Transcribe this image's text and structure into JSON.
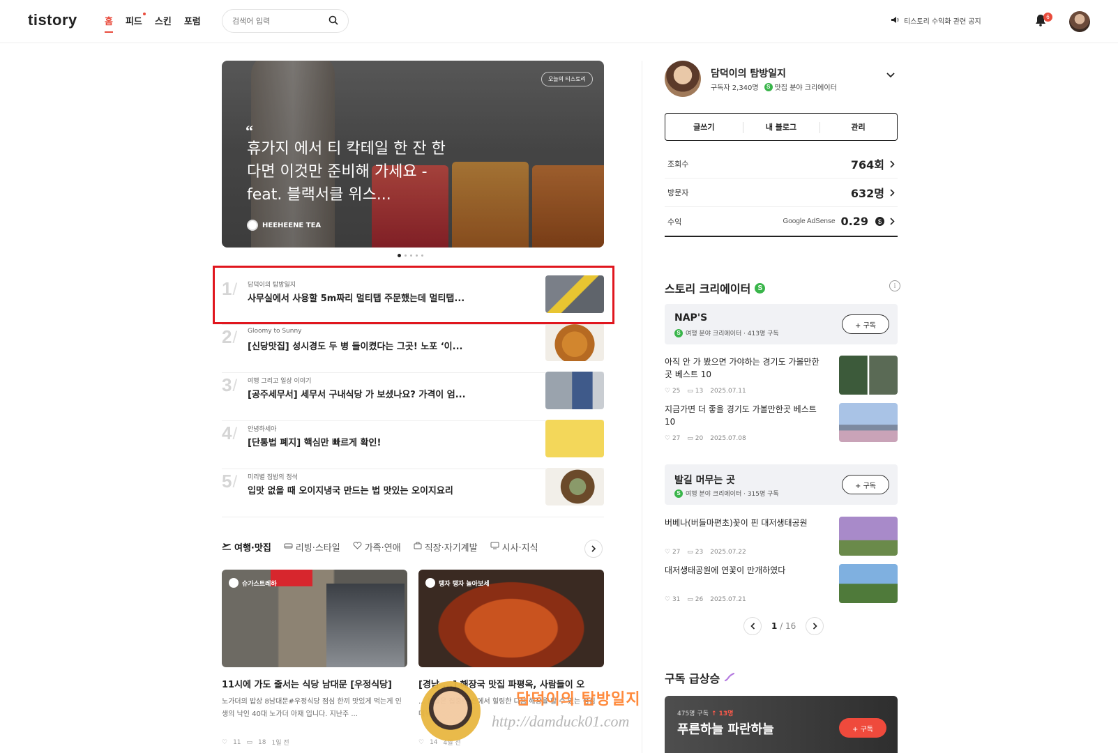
{
  "header": {
    "logo": "tistory",
    "nav": [
      {
        "label": "홈",
        "active": true
      },
      {
        "label": "피드",
        "new": true
      },
      {
        "label": "스킨"
      },
      {
        "label": "포럼"
      }
    ],
    "search_placeholder": "검색어 입력",
    "notice": "티스토리 수익화 관련 공지",
    "notification_count": "6"
  },
  "hero": {
    "badge": "오늘의 티스토리",
    "quote_mark": "“",
    "title": "휴가지 에서 티 칵테일 한 잔 한다면 이것만 준비해 가세요 - feat. 블랙서클 위스...",
    "author": "HEEHEENE TEA",
    "slide_index": 1,
    "slide_count": 5
  },
  "ranking": [
    {
      "rank": "1",
      "blog": "담덕이의 탐방일지",
      "title": "사무실에서 사용할 5m짜리 멀티탭 주문했는데 멀티탭..."
    },
    {
      "rank": "2",
      "blog": "Gloomy to Sunny",
      "title": "[신당맛집] 성시경도 두 병 들이켰다는 그곳! 노포 ‘이..."
    },
    {
      "rank": "3",
      "blog": "여행 그리고 일상 이야기",
      "title": "[공주세무서] 세무서 구내식당 가 보셨나요? 가격이 엄..."
    },
    {
      "rank": "4",
      "blog": "안녕하세아",
      "title": "[단통법 폐지] 핵심만 빠르게 확인!"
    },
    {
      "rank": "5",
      "blog": "미리별 집밥의 정석",
      "title": "입맛 없을 때 오이지냉국 만드는 법 맛있는 오이지요리"
    }
  ],
  "categories": [
    "여행·맛집",
    "리빙·스타일",
    "가족·연애",
    "직장·자기계발",
    "시사·지식"
  ],
  "cards": [
    {
      "chip": "슈가스트레하",
      "title": "11시에 가도 줄서는 식당 남대문 [우정식당]",
      "desc": "노가더의 밥상 8남대문#우정식당 점심 한끼 맛있게 먹는게 인생의 낙인 40대 노가더 아재 입니다. 지난주 ...",
      "likes": "11",
      "comments": "18",
      "time": "1일 전"
    },
    {
      "chip": "탱자 탱자 놀아보세",
      "title": "[경남 ...] 해장국 맛집 파평옥, 사람들이 오",
      "desc": "... 분들은 집중!펜션에서 힐링한 다음 해장을 할 수 있는 점심 메뉴...",
      "likes": "14",
      "comments": "",
      "time": "4일 전"
    }
  ],
  "watermark": {
    "text": "담덕이의 탐방일지",
    "url": "http://damduck01.com"
  },
  "profile": {
    "name": "담덕이의 탐방일지",
    "subscribers": "구독자 2,340명",
    "creator": "맛집 분야 크리에이터",
    "buttons": [
      "글쓰기",
      "내 블로그",
      "관리"
    ]
  },
  "stats": [
    {
      "label": "조회수",
      "value": "764회"
    },
    {
      "label": "방문자",
      "value": "632명"
    },
    {
      "label": "수익",
      "value": "0.29",
      "source": "Google AdSense"
    }
  ],
  "story_creator": {
    "title": "스토리 크리에이터",
    "groups": [
      {
        "name": "NAP'S",
        "meta": "여행 분야 크리에이터 · 413명 구독",
        "subscribe": "+ 구독",
        "posts": [
          {
            "title": "아직 안 가 봤으면 가야하는 경기도 가볼만한 곳 베스트 10",
            "likes": "25",
            "comments": "13",
            "date": "2025.07.11"
          },
          {
            "title": "지금가면 더 좋을 경기도 가볼만한곳 베스트 10",
            "likes": "27",
            "comments": "20",
            "date": "2025.07.08"
          }
        ]
      },
      {
        "name": "발길 머무는 곳",
        "meta": "여행 분야 크리에이터 · 315명 구독",
        "subscribe": "+ 구독",
        "posts": [
          {
            "title": "버베나(버들마편초)꽃이 핀 대저생태공원",
            "likes": "27",
            "comments": "23",
            "date": "2025.07.22"
          },
          {
            "title": "대저생태공원에 연꽃이 만개하였다",
            "likes": "31",
            "comments": "26",
            "date": "2025.07.21"
          }
        ]
      }
    ],
    "page": "1",
    "total_pages": "/ 16"
  },
  "trending": {
    "title": "구독 급상승",
    "meta": "475명 구독",
    "rise": "↑ 13명",
    "name": "푸른하늘 파란하늘",
    "subscribe": "+ 구독"
  },
  "colors": {
    "accent": "#e94b3c",
    "highlight": "#e0161e",
    "creator_green": "#39b54a"
  }
}
